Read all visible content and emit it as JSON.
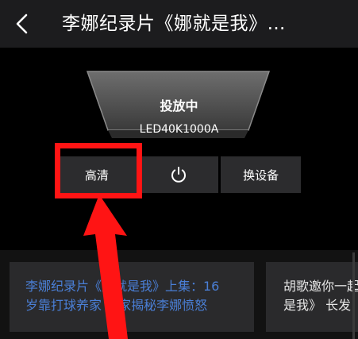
{
  "header": {
    "title": "李娜纪录片《娜就是我》…",
    "back_icon": "chevron-left-icon"
  },
  "cast": {
    "status": "投放中",
    "device_name": "LED40K1000A",
    "buttons": {
      "hd_label": "高清",
      "power_icon": "power-icon",
      "switch_label": "换设备"
    }
  },
  "videos": [
    {
      "title_line1": "李娜纪录片《娜就是我》上集：16",
      "title_line2": "岁靠打球养家 独家揭秘李娜愤怒"
    },
    {
      "title_line1": "胡歌邀你一起",
      "title_line2": "是我》 长发"
    }
  ],
  "colors": {
    "background": "#000000",
    "header": "#1c1c1e",
    "button": "#2c2c2e",
    "highlight": "#ff1414",
    "link_text": "#4a7fd6"
  }
}
